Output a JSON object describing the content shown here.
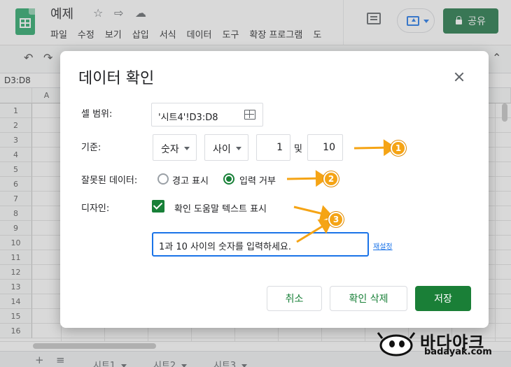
{
  "app": {
    "doc_title": "예제",
    "menus": [
      "파일",
      "수정",
      "보기",
      "삽입",
      "서식",
      "데이터",
      "도구",
      "확장 프로그램",
      "도"
    ],
    "share_label": "공유",
    "name_box": "D3:D8"
  },
  "sheet": {
    "columns": [
      "A"
    ],
    "rows": [
      "1",
      "2",
      "3",
      "4",
      "5",
      "6",
      "7",
      "8",
      "9",
      "10",
      "11",
      "12",
      "13",
      "14",
      "15",
      "16"
    ],
    "tabs": [
      "시트1",
      "시트2",
      "시트3"
    ]
  },
  "dialog": {
    "title": "데이터 확인",
    "range_label": "셀 범위:",
    "range_value": "'시트4'!D3:D8",
    "criteria_label": "기준:",
    "criteria_type": "숫자",
    "criteria_operator": "사이",
    "min_value": "1",
    "and_label": "및",
    "max_value": "10",
    "invalid_label": "잘못된 데이터:",
    "invalid_options": [
      {
        "label": "경고 표시",
        "selected": false
      },
      {
        "label": "입력 거부",
        "selected": true
      }
    ],
    "appearance_label": "디자인:",
    "help_checkbox_label": "확인 도움말 텍스트 표시",
    "help_checked": true,
    "help_text": "1과 10 사이의 숫자를 입력하세요.",
    "reset_link": "재설정",
    "buttons": {
      "cancel": "취소",
      "remove": "확인 삭제",
      "save": "저장"
    }
  },
  "annotations": [
    "1",
    "2",
    "3"
  ],
  "watermark": {
    "text": "바다야크",
    "sub": "badayak.com"
  },
  "colors": {
    "primary_green": "#188038",
    "accent_blue": "#1a73e8",
    "annotation_orange": "#f5a415"
  }
}
